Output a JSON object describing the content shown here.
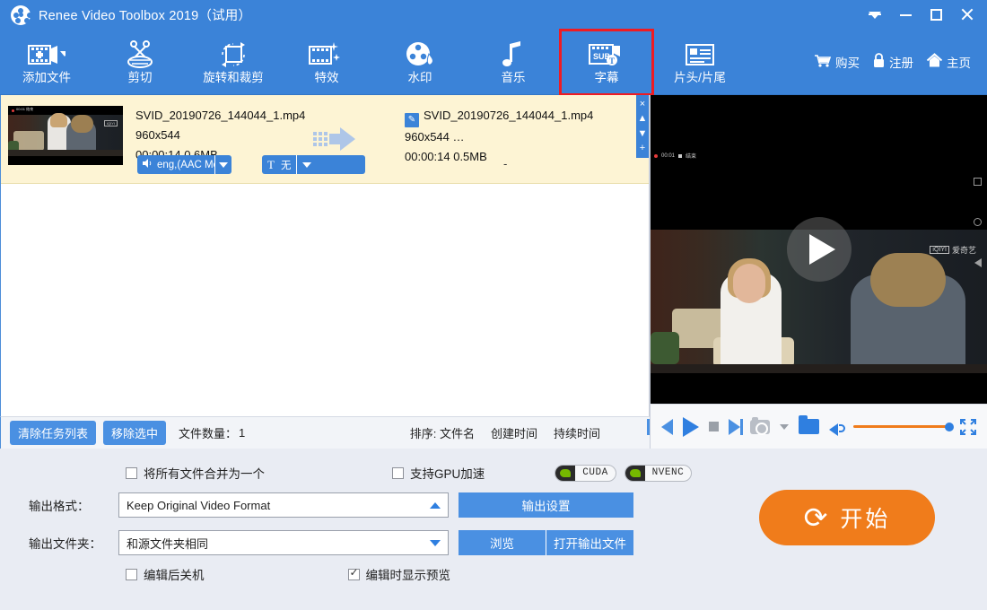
{
  "titlebar": {
    "app_title": "Renee Video Toolbox 2019（试用）",
    "logo_icon": "film-reel-icon",
    "controls": [
      {
        "name": "collapse-ribbon-button",
        "icon": "triangle-down-icon"
      },
      {
        "name": "minimize-button",
        "icon": "minimize-icon"
      },
      {
        "name": "maximize-button",
        "icon": "maximize-icon"
      },
      {
        "name": "close-button",
        "icon": "close-icon"
      }
    ]
  },
  "toolbar": {
    "items": [
      {
        "label": "添加文件",
        "icon": "film-plus-icon",
        "has_caret": true,
        "highlighted": false
      },
      {
        "label": "剪切",
        "icon": "scissors-icon",
        "has_caret": false,
        "highlighted": false
      },
      {
        "label": "旋转和裁剪",
        "icon": "rotate-crop-icon",
        "has_caret": false,
        "highlighted": false
      },
      {
        "label": "特效",
        "icon": "effects-icon",
        "has_caret": false,
        "highlighted": false
      },
      {
        "label": "水印",
        "icon": "watermark-icon",
        "has_caret": false,
        "highlighted": false
      },
      {
        "label": "音乐",
        "icon": "music-note-icon",
        "has_caret": false,
        "highlighted": false
      },
      {
        "label": "字幕",
        "icon": "subtitle-icon",
        "has_caret": false,
        "highlighted": true
      },
      {
        "label": "片头/片尾",
        "icon": "intro-outro-icon",
        "has_caret": false,
        "highlighted": false
      }
    ],
    "right_links": [
      {
        "label": "购买",
        "icon": "cart-icon"
      },
      {
        "label": "注册",
        "icon": "lock-icon"
      },
      {
        "label": "主页",
        "icon": "home-icon"
      }
    ],
    "highlight_color": "#ef1b22",
    "bg_color": "#3b83d8"
  },
  "task": {
    "source": {
      "filename": "SVID_20190726_144044_1.mp4",
      "resolution": "960x544",
      "duration_size": "00:00:14  0.6MB"
    },
    "output": {
      "edit_badge_icon": "pencil-icon",
      "filename": "SVID_20190726_144044_1.mp4",
      "resolution": "960x544   …",
      "duration_size": "00:00:14  0.5MB"
    },
    "audio_track": "eng,(AAC Mon",
    "audio_icon": "speaker-icon",
    "subtitle_track": "无",
    "subtitle_icon": "subtitle-t-icon",
    "effect_value": "-",
    "thumbnail_overlay": "00:01  结束",
    "side_strip": [
      "×",
      "▲",
      "▼",
      "+"
    ]
  },
  "list_bar": {
    "clear_list_label": "清除任务列表",
    "remove_selected_label": "移除选中",
    "file_count_label": "文件数量：",
    "file_count_value": "1",
    "sort_prefix": "排序:",
    "sort_options": [
      "文件名",
      "创建时间",
      "持续时间"
    ]
  },
  "preview": {
    "recording_time": "00:01",
    "recording_label": "结束",
    "watermark_brand": "iQIYI",
    "watermark_cn": "爱奇艺",
    "play_icon": "play-triangle-icon",
    "controls": [
      {
        "name": "previous-frame-button",
        "icon": "skip-previous-icon"
      },
      {
        "name": "play-button",
        "icon": "play-icon"
      },
      {
        "name": "stop-button",
        "icon": "stop-icon"
      },
      {
        "name": "next-frame-button",
        "icon": "skip-next-icon"
      },
      {
        "name": "snapshot-button",
        "icon": "camera-icon"
      },
      {
        "name": "snapshot-dropdown",
        "icon": "caret-down-icon"
      },
      {
        "name": "open-folder-button",
        "icon": "folder-icon"
      },
      {
        "name": "volume-button",
        "icon": "speaker-icon"
      },
      {
        "name": "volume-slider",
        "icon": "slider-icon"
      },
      {
        "name": "fullscreen-button",
        "icon": "fullscreen-icon"
      }
    ],
    "volume_color": "#f07c1b"
  },
  "footer": {
    "merge_files_label": "将所有文件合并为一个",
    "merge_files_checked": false,
    "gpu_accel_label": "支持GPU加速",
    "gpu_accel_checked": false,
    "badges": [
      {
        "text": "CUDA",
        "icon": "nvidia-icon"
      },
      {
        "text": "NVENC",
        "icon": "nvidia-icon"
      }
    ],
    "format_label": "输出格式：",
    "format_value": "Keep Original Video Format",
    "format_caret": "caret-up-icon",
    "output_settings_label": "输出设置",
    "folder_label": "输出文件夹：",
    "folder_value": "和源文件夹相同",
    "folder_caret": "caret-down-icon",
    "browse_label": "浏览",
    "open_output_label": "打开输出文件",
    "shutdown_label": "编辑后关机",
    "shutdown_checked": false,
    "preview_label": "编辑时显示预览",
    "preview_checked": true,
    "start_label": "开始",
    "start_icon": "refresh-circle-icon",
    "start_color": "#f07c1b"
  }
}
